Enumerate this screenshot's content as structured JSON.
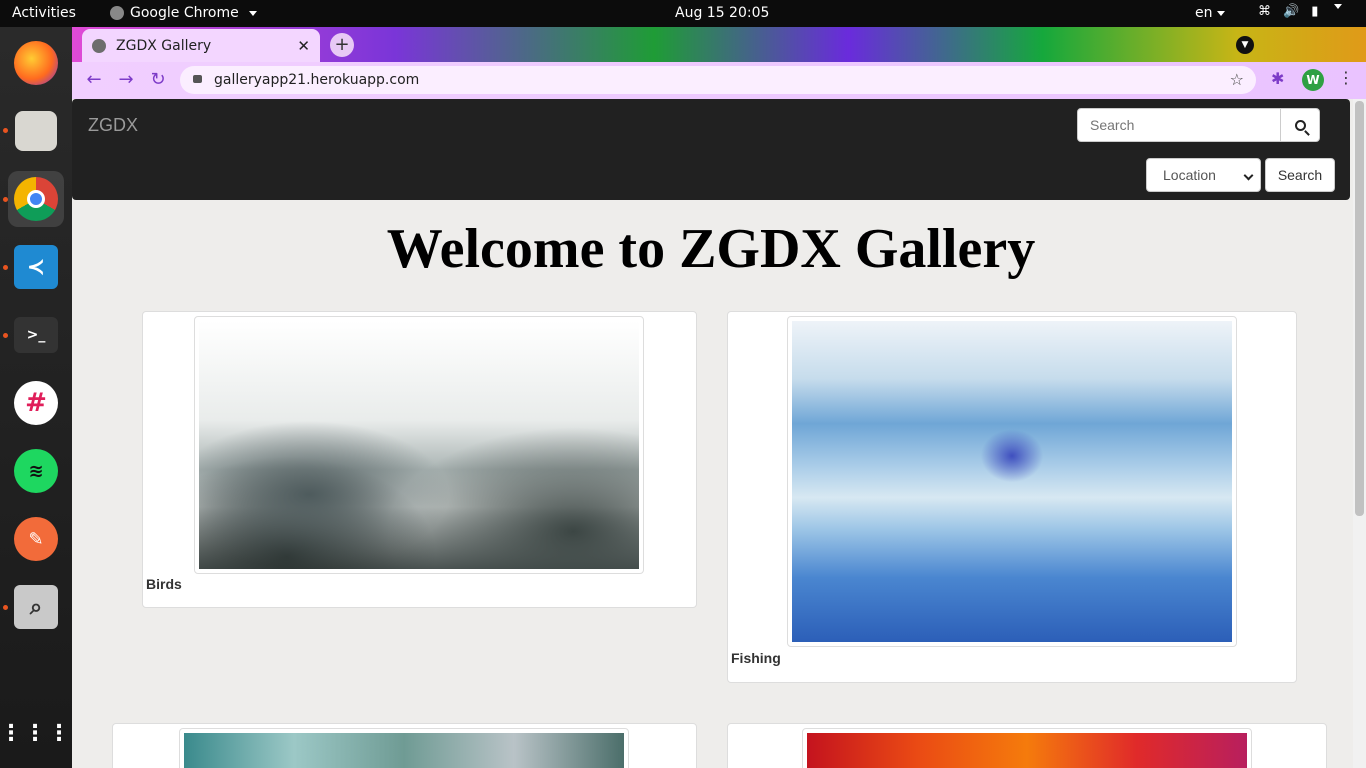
{
  "system": {
    "activities_label": "Activities",
    "app_name": "Google Chrome",
    "clock": "Aug 15  20:05",
    "language": "en"
  },
  "dock": {
    "apps": [
      "firefox-icon",
      "files-icon",
      "chrome-icon",
      "vscode-icon",
      "terminal-icon",
      "slack-icon",
      "spotify-icon",
      "postman-icon",
      "image-viewer-icon",
      "app-grid-icon"
    ]
  },
  "browser": {
    "tab_title": "ZGDX Gallery",
    "url": "galleryapp21.herokuapp.com",
    "profile_initial": "W",
    "accent_color": "#7d3bc8"
  },
  "site": {
    "brand": "ZGDX",
    "search_placeholder": "Search",
    "location_selected": "Location",
    "search_button": "Search",
    "heading": "Welcome to ZGDX Gallery",
    "cards": [
      {
        "caption": "Birds"
      },
      {
        "caption": "Fishing"
      },
      {
        "caption": ""
      },
      {
        "caption": ""
      }
    ]
  }
}
